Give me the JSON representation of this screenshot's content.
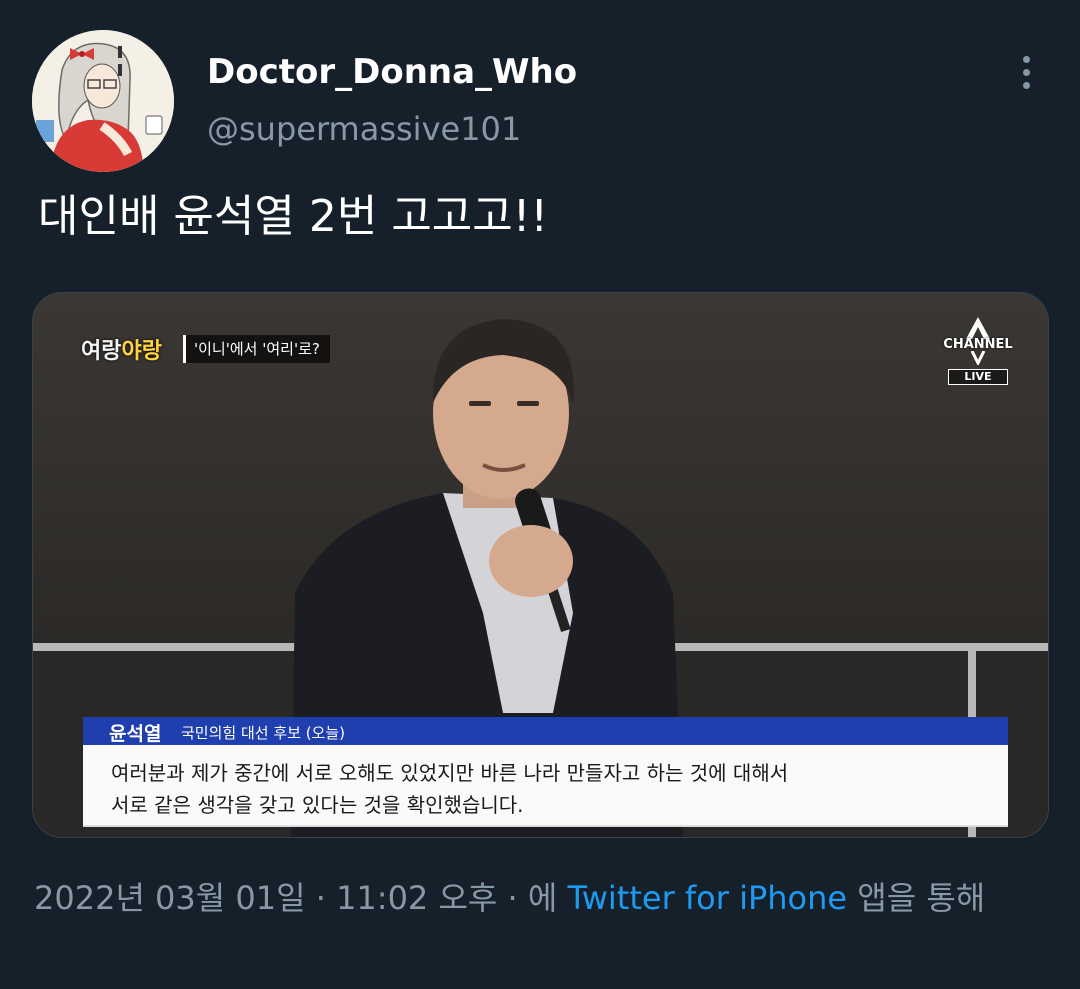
{
  "author": {
    "display_name": "Doctor_Donna_Who",
    "handle": "@supermassive101"
  },
  "tweet": {
    "text": "대인배 윤석열 2번 고고고!!"
  },
  "media": {
    "show_logo_main": "여랑",
    "show_logo_accent": "야랑",
    "topic_tag": "'이니'에서 '여리'로?",
    "channel_name": "CHANNEL",
    "live_label": "LIVE",
    "caption": {
      "name": "윤석열",
      "role": "국민의힘 대선 후보 (오늘)",
      "line1": "여러분과 제가 중간에 서로 오해도 있었지만 바른 나라 만들자고 하는 것에 대해서",
      "line2": "서로 같은 생각을 갖고 있다는 것을 확인했습니다."
    }
  },
  "meta": {
    "date": "2022년 03월 01일",
    "sep1": " · ",
    "time": "11:02 오후",
    "sep2": " · 에 ",
    "source": "Twitter for iPhone",
    "suffix": " 앱을 통해"
  },
  "icons": {
    "more": "more-vertical-icon",
    "avatar": "avatar"
  }
}
